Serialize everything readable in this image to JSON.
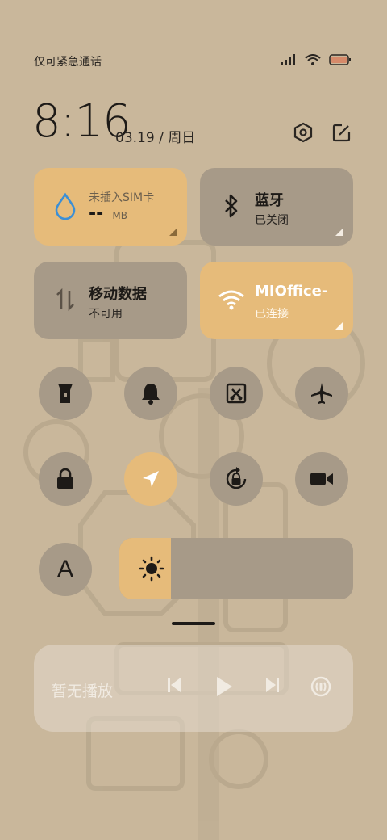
{
  "status_bar": {
    "carrier_text": "仅可紧急通话",
    "signal_icon": "signal-icon",
    "wifi_icon": "wifi-icon",
    "battery_icon": "battery-icon"
  },
  "header": {
    "time": "8:16",
    "date": "03.19 / 周日",
    "settings_icon": "hexagon-settings-icon",
    "edit_icon": "edit-icon"
  },
  "tiles": {
    "data_usage": {
      "title": "未插入SIM卡",
      "value": "--",
      "unit": "MB"
    },
    "bluetooth": {
      "title": "蓝牙",
      "status": "已关闭"
    },
    "mobile_data": {
      "title": "移动数据",
      "status": "不可用"
    },
    "wifi": {
      "title": "MIOffice-",
      "status": "已连接"
    }
  },
  "toggles": [
    {
      "name": "flashlight",
      "active": false
    },
    {
      "name": "bell",
      "active": false
    },
    {
      "name": "screenshot",
      "active": false
    },
    {
      "name": "airplane",
      "active": false
    },
    {
      "name": "lock",
      "active": false
    },
    {
      "name": "location",
      "active": true
    },
    {
      "name": "rotation-lock",
      "active": false
    },
    {
      "name": "screen-record",
      "active": false
    }
  ],
  "font_toggle": {
    "glyph": "A"
  },
  "brightness": {
    "level": 0.22
  },
  "media": {
    "label": "暂无播放"
  },
  "colors": {
    "accent": "#e6bb7a",
    "tile_off": "#a79a88",
    "background": "#c9b79b"
  }
}
